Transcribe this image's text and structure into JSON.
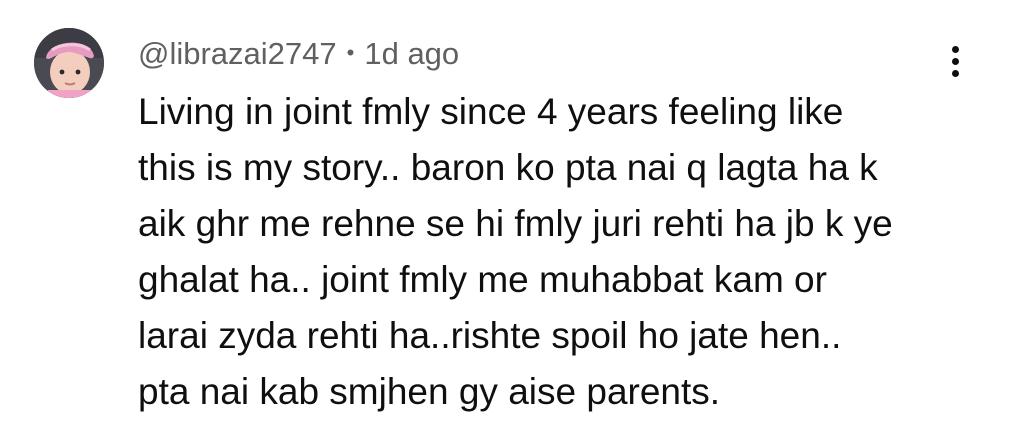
{
  "comment": {
    "author": "@librazai2747",
    "separator": "•",
    "time": "1d ago",
    "text_lines": [
      "Living in joint fmly since 4 years feeling like",
      "this is my story.. baron ko pta nai q lagta ha k",
      "aik ghr me rehne se hi fmly juri rehti ha jb k ye",
      "ghalat ha.. joint fmly me muhabbat kam or",
      "larai zyda rehti ha..rishte spoil ho jate hen..",
      "pta nai kab smjhen gy aise parents."
    ]
  },
  "icons": {
    "avatar": "profile-avatar-child",
    "menu": "more-vert-icon"
  },
  "colors": {
    "meta_text": "#606060",
    "body_text": "#0f0f0f",
    "background": "#ffffff"
  }
}
